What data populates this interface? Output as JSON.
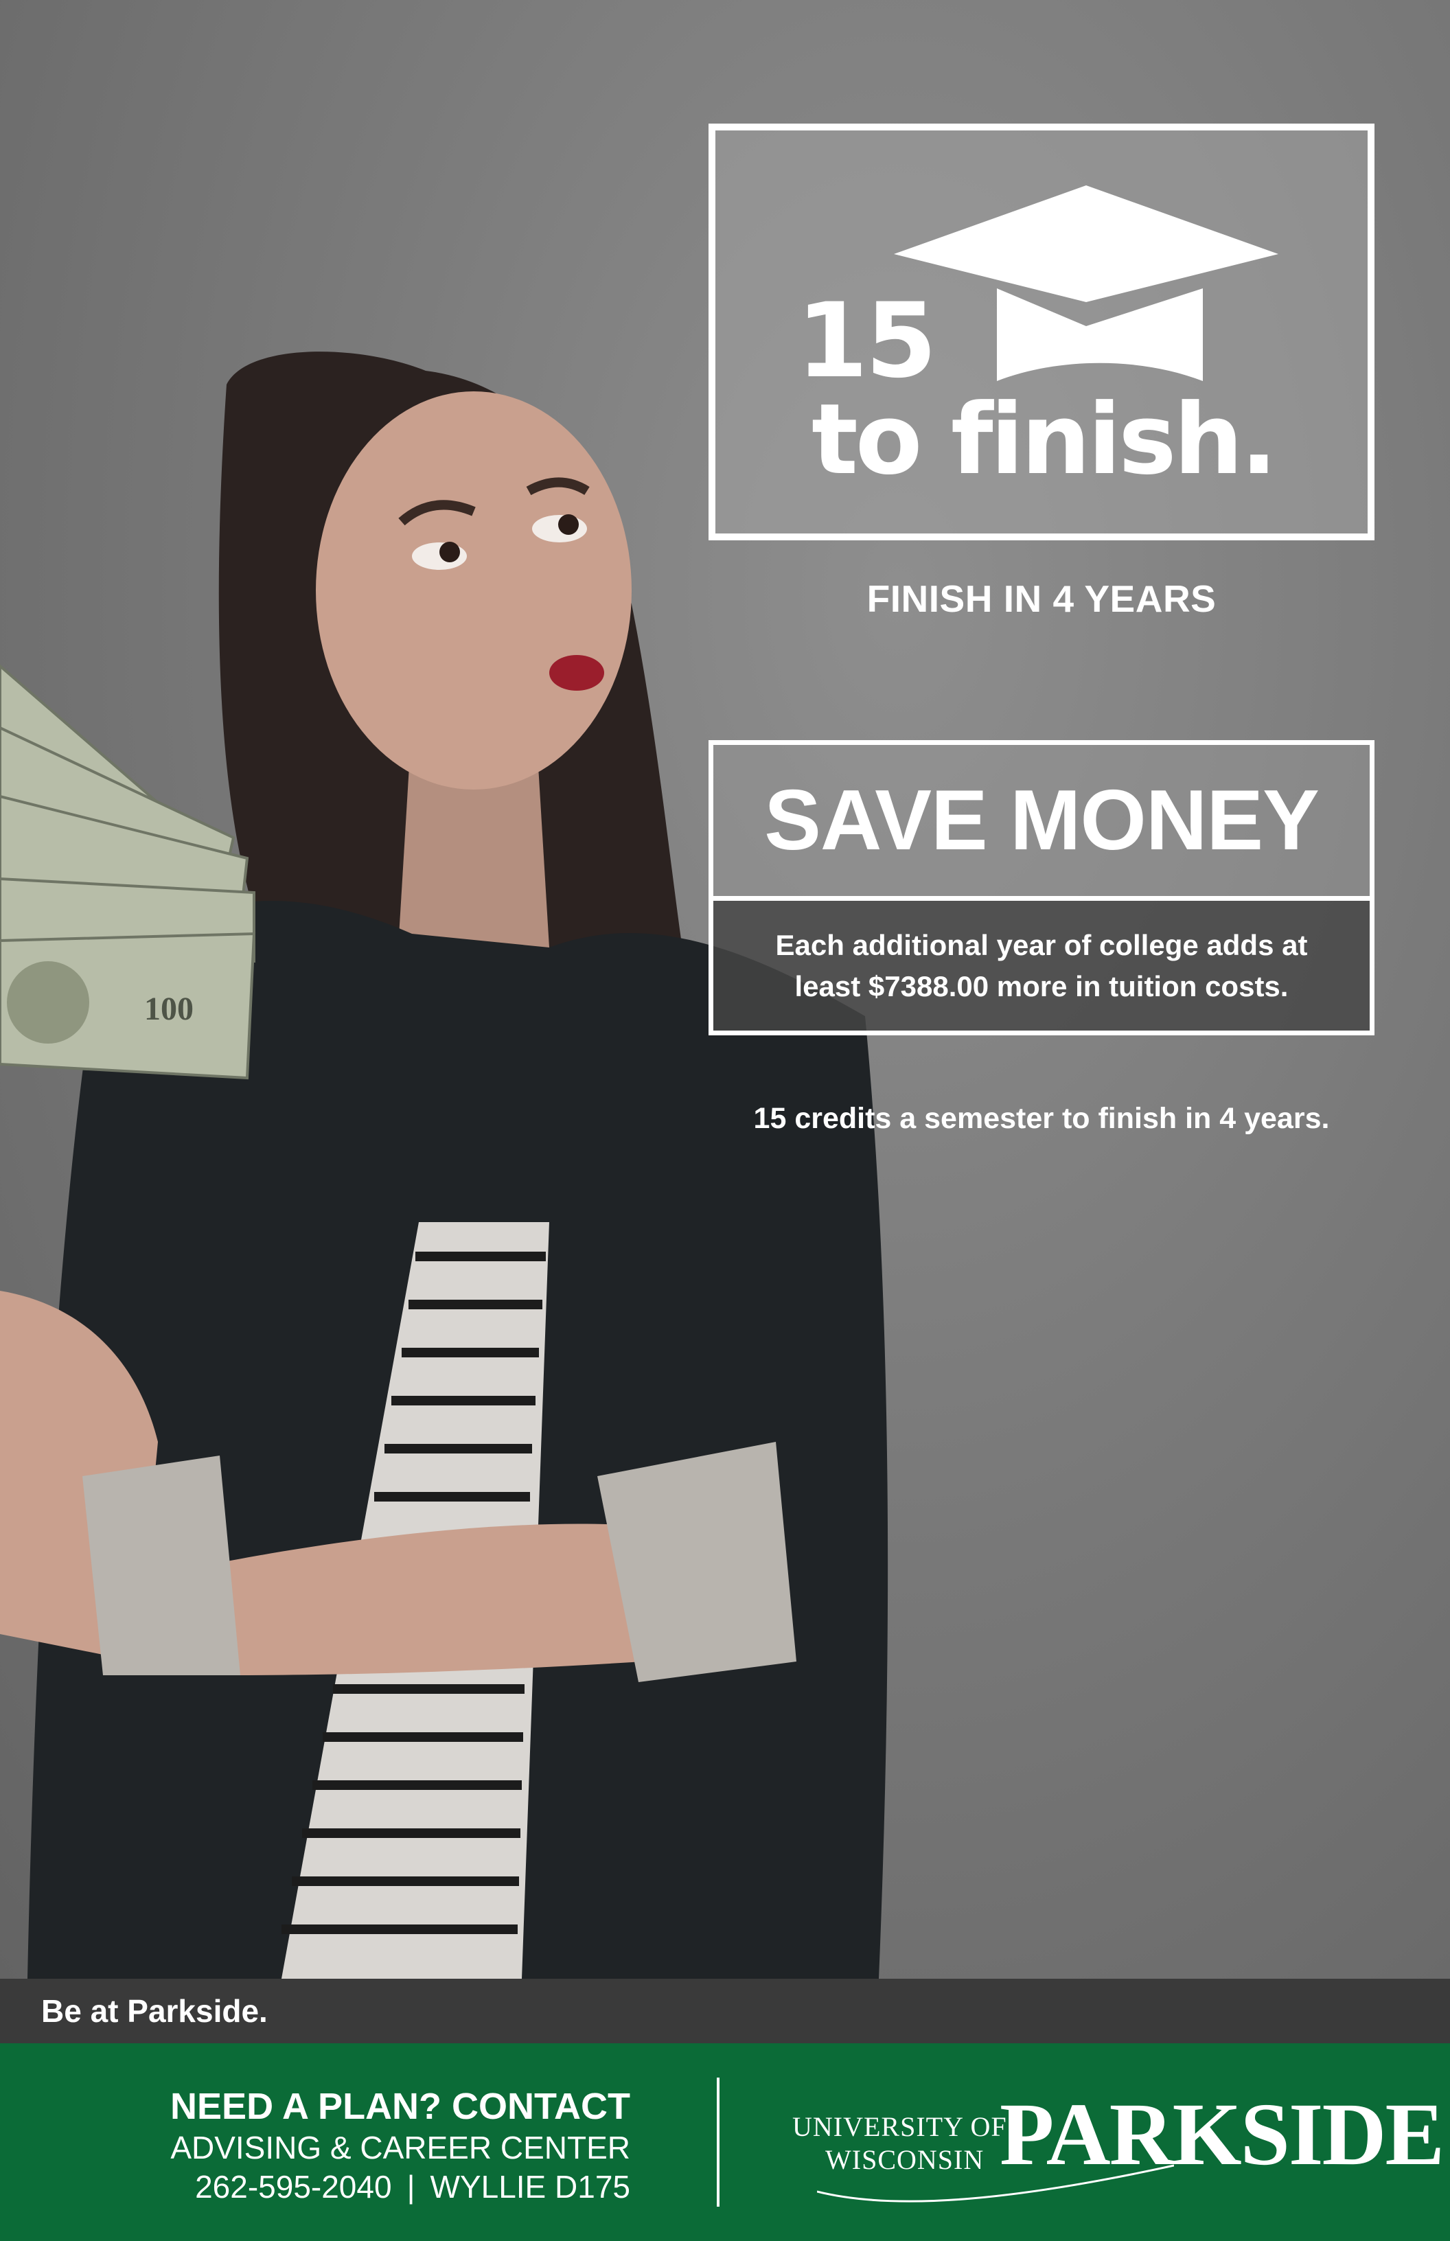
{
  "logo": {
    "number": "15",
    "text": "to finish."
  },
  "headline": "FINISH IN 4 YEARS",
  "save": {
    "title": "SAVE MONEY",
    "line1": "Each additional year of college adds at",
    "line2": "least $7388.00 more in tuition costs."
  },
  "credits": "15 credits a semester to finish in 4 years.",
  "tagline": "Be at Parkside.",
  "contact": {
    "heading": "NEED A PLAN? CONTACT",
    "department": "ADVISING & CAREER CENTER",
    "phone": "262-595-2040",
    "separator": "|",
    "location": "WYLLIE D175"
  },
  "brand": {
    "university": "UNIVERSITY OF",
    "state": "WISCONSIN",
    "name": "PARKSIDE"
  },
  "colors": {
    "footer_green": "#0b6b37",
    "tagline_bar": "#3a3a3a",
    "background_gray": "#7a7a7a",
    "text": "#ffffff"
  },
  "icons": [
    "graduation-cap-icon"
  ]
}
